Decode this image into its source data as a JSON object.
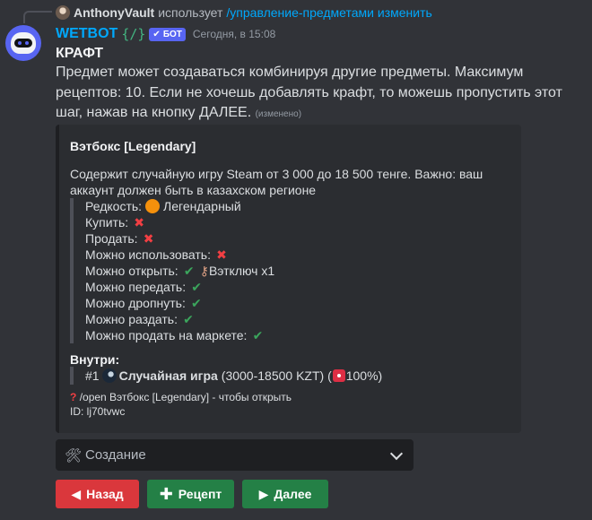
{
  "reply": {
    "user": "AnthonyVault",
    "verb": "использует",
    "command": "/управление-предметами изменить"
  },
  "bot": {
    "name": "WETBOT",
    "tag": "{/}",
    "badge": "БОТ",
    "timestamp": "Сегодня, в 15:08"
  },
  "message": {
    "title": "КРАФТ",
    "body": "Предмет может создаваться комбинируя другие предметы. Максимум рецептов: 10. Если не хочешь добавлять крафт, то можешь пропустить этот шаг, нажав на кнопку ДАЛЕЕ.",
    "edited": "(изменено)"
  },
  "embed": {
    "title": "Вэтбокс [Legendary]",
    "description": "Содержит случайную игру Steam от 3 000 до 18 500 тенге. Важно: ваш аккаунт должен быть в казахском регионе",
    "rarity_label": "Редкость:",
    "rarity_value": "Легендарный",
    "buy_label": "Купить:",
    "sell_label": "Продать:",
    "use_label": "Можно использовать:",
    "open_label": "Можно открыть:",
    "open_key": "Вэтключ x1",
    "transfer_label": "Можно передать:",
    "drop_label": "Можно дропнуть:",
    "giveaway_label": "Можно раздать:",
    "market_label": "Можно продать на маркете:",
    "inside_title": "Внутри:",
    "inside_number": "#1",
    "inside_name": "Случайная игра",
    "inside_range": "(3000-18500 KZT) (",
    "inside_chance": "100%)",
    "footer_cmd": "/open Вэтбокс [Legendary] - чтобы открыть",
    "footer_id": "ID: lj70tvwc"
  },
  "select": {
    "value": "Создание"
  },
  "buttons": {
    "back": "Назад",
    "recipe": "Рецепт",
    "next": "Далее"
  },
  "colors": {
    "background": "#313338",
    "embed": "#2b2d31",
    "link": "#00a8fc",
    "danger": "#da373c",
    "success": "#248046",
    "badge": "#5865f2"
  }
}
